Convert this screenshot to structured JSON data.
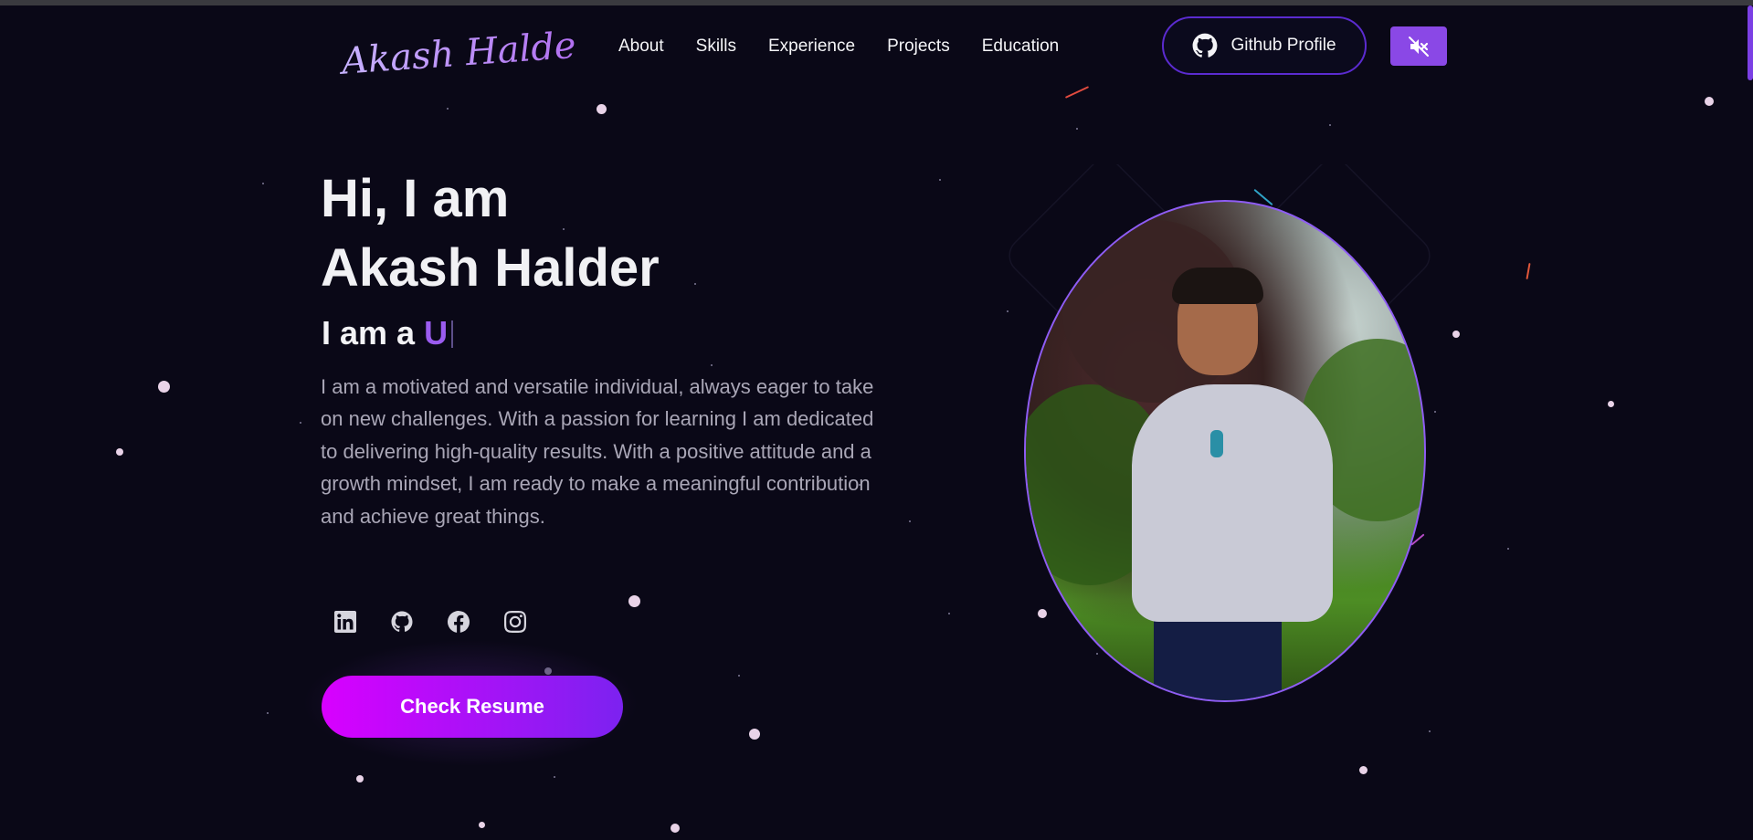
{
  "nav": {
    "logo_text": "Akash Halder",
    "links": [
      "About",
      "Skills",
      "Experience",
      "Projects",
      "Education"
    ],
    "github_label": "Github Profile",
    "sound_icon": "volume-muted-icon"
  },
  "hero": {
    "greeting_line1": "Hi, I am",
    "greeting_line2": "Akash Halder",
    "role_prefix": "I am a",
    "role_typed": "U",
    "about": "I am a motivated and versatile individual, always eager to take on new challenges. With a passion for learning I am dedicated to delivering high-quality results. With a positive attitude and a growth mindset, I am ready to make a meaningful contribution and achieve great things.",
    "socials": [
      "linkedin-icon",
      "github-icon",
      "facebook-icon",
      "instagram-icon"
    ],
    "resume_label": "Check Resume"
  },
  "colors": {
    "background": "#0a0817",
    "accent": "#8a48e6",
    "button_gradient_start": "#d800ff",
    "button_gradient_end": "#7c22f0",
    "typed_text": "#9b5cf0"
  }
}
